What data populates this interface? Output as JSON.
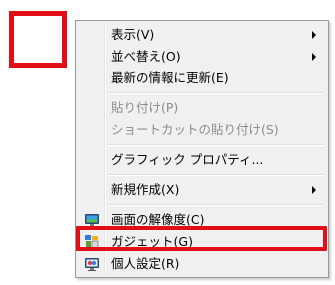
{
  "annotation": {
    "accent_color": "#e10e17"
  },
  "menu": {
    "items": [
      {
        "label": "表示(V)",
        "submenu": true,
        "enabled": true
      },
      {
        "label": "並べ替え(O)",
        "submenu": true,
        "enabled": true
      },
      {
        "label": "最新の情報に更新(E)",
        "submenu": false,
        "enabled": true
      },
      {
        "label": "貼り付け(P)",
        "submenu": false,
        "enabled": false
      },
      {
        "label": "ショートカットの貼り付け(S)",
        "submenu": false,
        "enabled": false
      },
      {
        "label": "グラフィック プロパティ...",
        "submenu": false,
        "enabled": true
      },
      {
        "label": "新規作成(X)",
        "submenu": true,
        "enabled": true
      },
      {
        "label": "画面の解像度(C)",
        "submenu": false,
        "enabled": true,
        "icon": "display-icon"
      },
      {
        "label": "ガジェット(G)",
        "submenu": false,
        "enabled": true,
        "icon": "gadget-icon",
        "highlighted": true
      },
      {
        "label": "個人設定(R)",
        "submenu": false,
        "enabled": true,
        "icon": "personalize-icon"
      }
    ]
  }
}
